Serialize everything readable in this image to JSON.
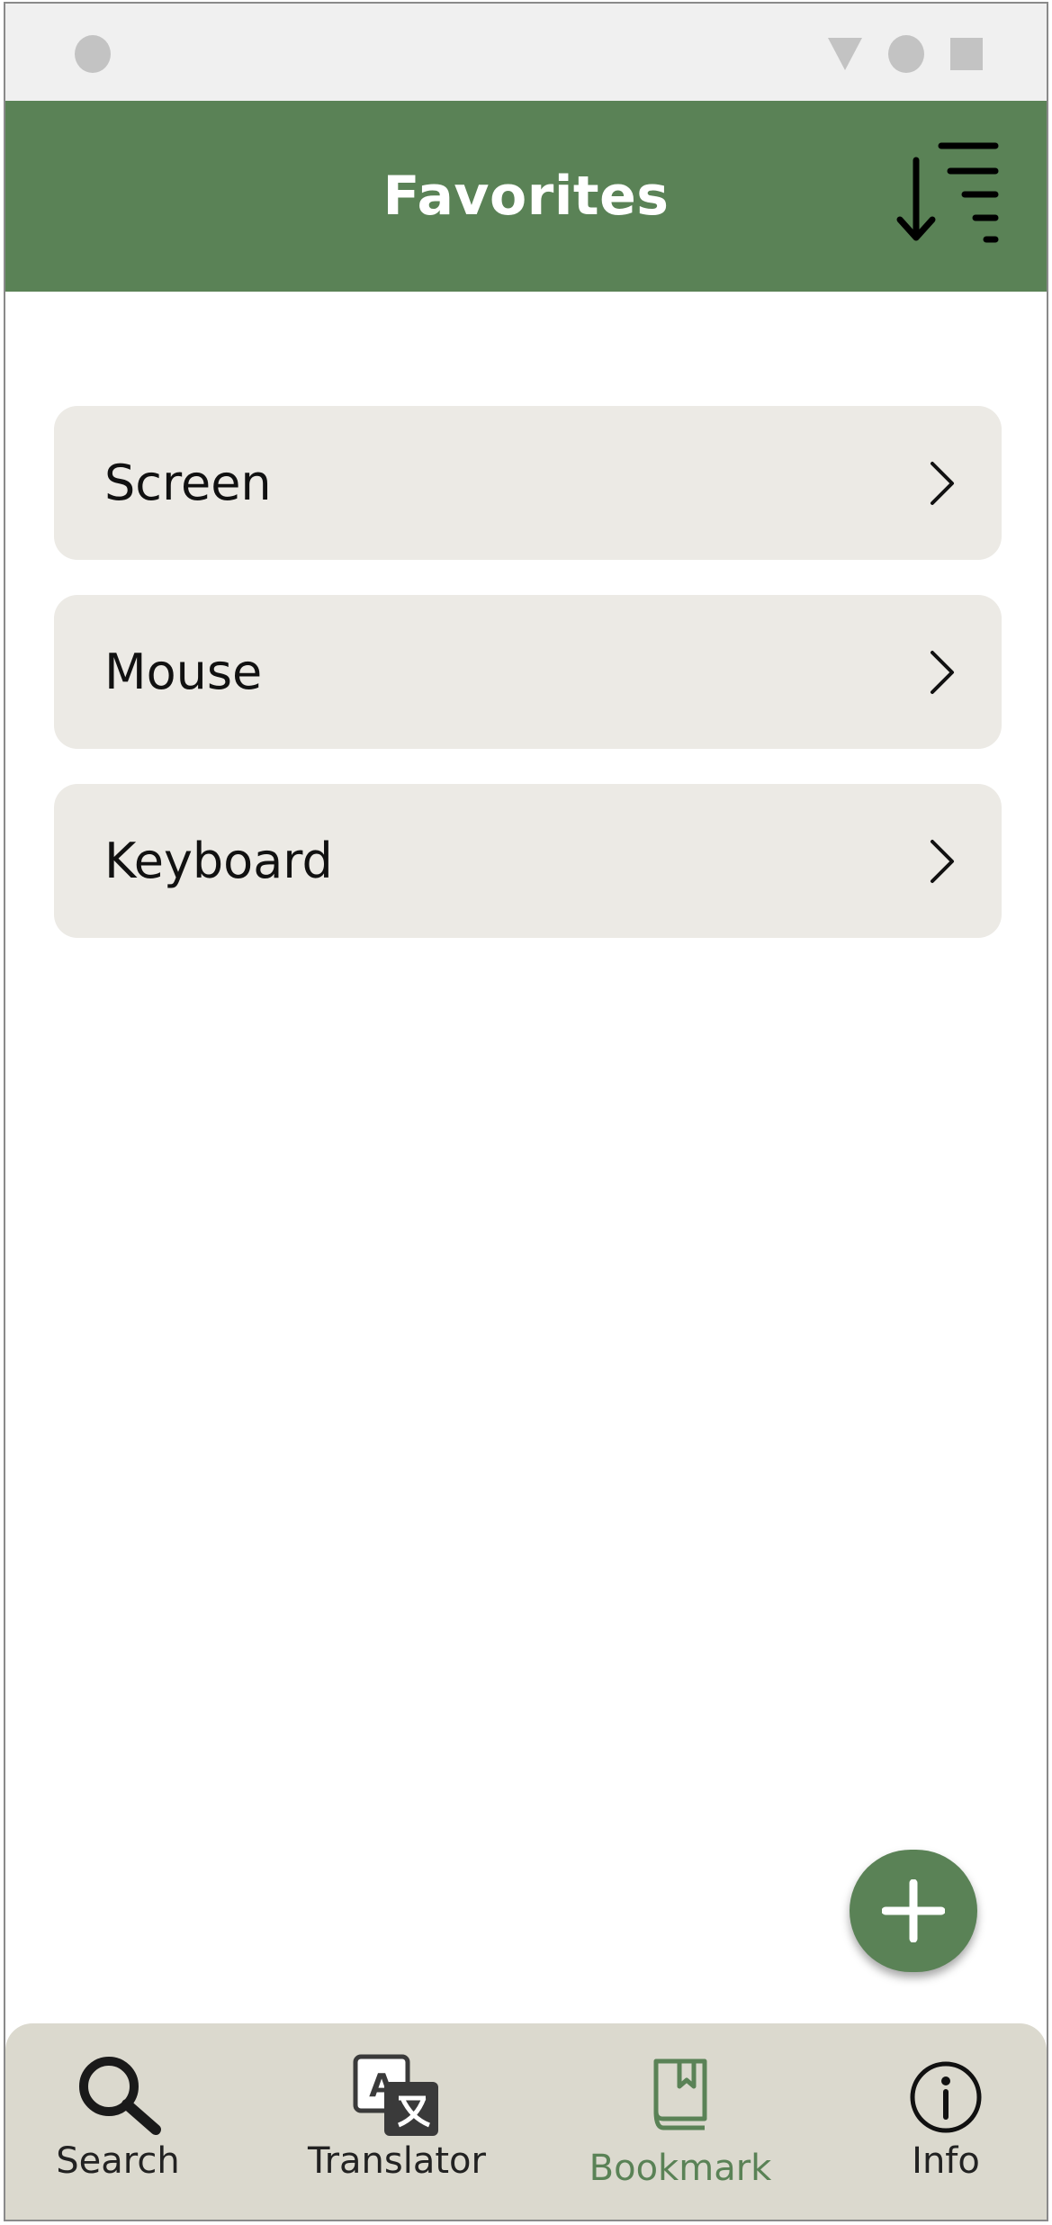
{
  "app_bar": {
    "title": "Favorites",
    "sort_icon": "sort-descending-icon"
  },
  "favorites": [
    {
      "label": "Screen",
      "icon": "chevron-right-icon"
    },
    {
      "label": "Mouse",
      "icon": "chevron-right-icon"
    },
    {
      "label": "Keyboard",
      "icon": "chevron-right-icon"
    }
  ],
  "fab": {
    "icon": "plus-icon"
  },
  "bottom_nav": {
    "items": [
      {
        "label": "Search",
        "icon": "search-icon",
        "active": false
      },
      {
        "label": "Translator",
        "icon": "translate-icon",
        "active": false
      },
      {
        "label": "Bookmark",
        "icon": "bookmark-book-icon",
        "active": true
      },
      {
        "label": "Info",
        "icon": "info-icon",
        "active": false
      }
    ]
  },
  "colors": {
    "primary": "#5a8256",
    "list_item_bg": "#eceae5",
    "nav_bg": "#dbd9ce",
    "status_bar_bg": "#f0f0f0"
  }
}
